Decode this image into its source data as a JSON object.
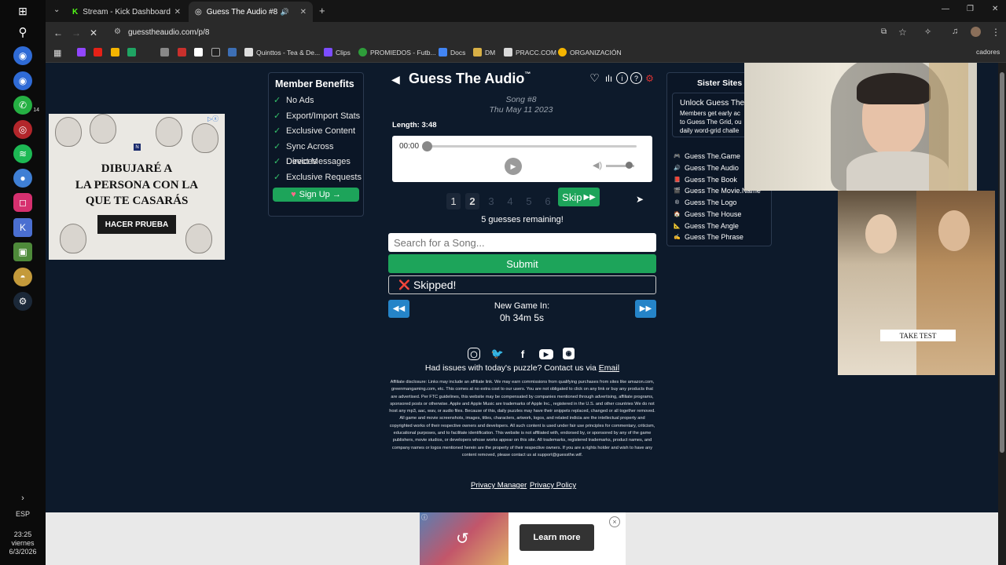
{
  "tabs": [
    {
      "title": "Stream - Kick Dashboard"
    },
    {
      "title": "Guess The Audio #8"
    }
  ],
  "address": "guesstheaudio.com/p/8",
  "bookmarks": [
    "Quinttos - Tea & De...",
    "Clips",
    "PROMIEDOS - Futb...",
    "Docs",
    "DM",
    "PRACC.COM",
    "ORGANIZACIÓN"
  ],
  "bookmarks_overflow": "cadores",
  "taskbar": {
    "badge": "14",
    "lang": "ESP",
    "time": "23:25",
    "day": "viernes",
    "date": "6/3/2026"
  },
  "ad_left": {
    "headline_1": "DIBUJARÉ A",
    "headline_2": "LA PERSONA CON LA",
    "headline_3": "QUE TE CASARÁS",
    "cta": "HACER PRUEBA",
    "brand": "N"
  },
  "benefits": {
    "title": "Member Benefits",
    "items": [
      "No Ads",
      "Export/Import Stats",
      "Exclusive Content",
      "Sync Across Devices",
      "Direct Messages",
      "Exclusive Requests"
    ],
    "signup": "Sign Up →",
    "signup_heart": "♥"
  },
  "game": {
    "title": "Guess The Audio",
    "tm": "™",
    "song": "Song #8",
    "date": "Thu May 11 2023",
    "length": "Length: 3:48",
    "time": "00:00",
    "guesses": [
      "1",
      "2",
      "3",
      "4",
      "5",
      "6"
    ],
    "skip": "Skip",
    "remaining": "5 guesses remaining!",
    "search_placeholder": "Search for a Song...",
    "submit": "Submit",
    "skipped_icon": "❌",
    "skipped": "Skipped!",
    "new_game_label": "New Game In:",
    "countdown": "0h 34m 5s",
    "contact_text": "Had issues with today's puzzle? Contact us via",
    "contact_link": "Email",
    "disclosure": "Affiliate disclosure: Links may include an affiliate link. We may earn commissions from qualifying purchases from sites like amazon.com, greenmangaming.com, etc. This comes at no extra cost to our users. You are not obligated to click on any link or buy any products that are advertised. Per FTC guidelines, this website may be compensated by companies mentioned through advertising, affiliate programs, sponsored posts or otherwise. Apple and Apple Music are trademarks of Apple Inc., registered in the U.S. and other countries We do not host any mp3, aac, wav, or audio files. Because of this, daily puzzles may have their snippets replaced, changed or all together removed. All game and movie screenshots, images, titles, characters, artwork, logos, and related indicia are the intellectual property and copyrighted works of their respective owners and developers. All such content is used under fair use principles for commentary, criticism, educational purposes, and to facilitate identification. This website is not affiliated with, endorsed by, or sponsored by any of the game publishers, movie studios, or developers whose works appear on this site. All trademarks, registered trademarks, product names, and company names or logos mentioned herein are the property of their respective owners. If you are a rights holder and wish to have any content removed, please contact us at support@guessthe.wtf.",
    "privacy_manager": "Privacy Manager",
    "privacy_policy": "Privacy Policy"
  },
  "sister": {
    "title": "Sister Sites",
    "unlock_title": "Unlock Guess The",
    "unlock_desc_1": "Members get early ac",
    "unlock_desc_2": "to Guess The Grid, ou",
    "unlock_desc_3": "daily word-grid challe",
    "sites": [
      {
        "icon": "🎮",
        "label": "Guess The.Game"
      },
      {
        "icon": "🔊",
        "label": "Guess The Audio"
      },
      {
        "icon": "📕",
        "label": "Guess The Book"
      },
      {
        "icon": "🎬",
        "label": "Guess The Movie.Name"
      },
      {
        "icon": "®",
        "label": "Guess The Logo"
      },
      {
        "icon": "🏠",
        "label": "Guess The House"
      },
      {
        "icon": "📐",
        "label": "Guess The Angle"
      },
      {
        "icon": "✍",
        "label": "Guess The Phrase"
      }
    ]
  },
  "ad_right": {
    "cta": "TAKE TEST"
  },
  "ad_bottom": {
    "cta": "Learn more",
    "close": "×"
  },
  "colors": {
    "accent_green": "#1da45a",
    "nav_blue": "#2584c8",
    "page_bg": "#0d1a2b"
  }
}
